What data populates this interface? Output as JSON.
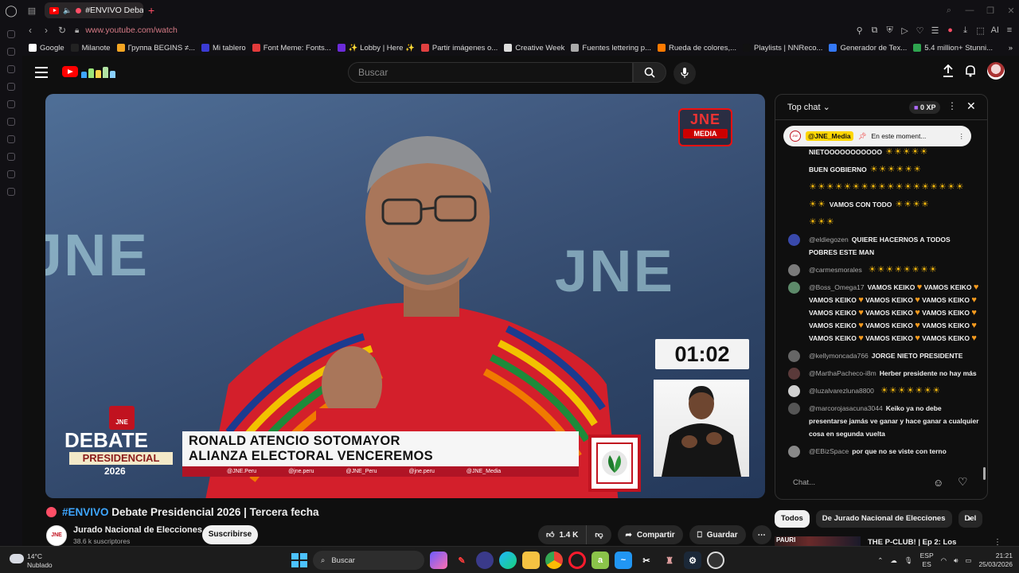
{
  "browser": {
    "tab_title": "#ENVIVO Debate P",
    "url": "www.youtube.com/watch",
    "ai_label": "AI",
    "bookmarks": [
      {
        "label": "Google",
        "color": "#ffffff"
      },
      {
        "label": "Milanote",
        "color": "#222222"
      },
      {
        "label": "Группа BEGINS ≠...",
        "color": "#f5a623"
      },
      {
        "label": "Mi tablero",
        "color": "#3b3bd4"
      },
      {
        "label": "Font Meme: Fonts...",
        "color": "#e23b3b"
      },
      {
        "label": "✨ Lobby | Here ✨",
        "color": "#6c2bd9"
      },
      {
        "label": "Partir imágenes o...",
        "color": "#e04040"
      },
      {
        "label": "Creative Week",
        "color": "#dddddd"
      },
      {
        "label": "Fuentes lettering p...",
        "color": "#aaaaaa"
      },
      {
        "label": "Rueda de colores,...",
        "color": "#ff7a00"
      },
      {
        "label": "Playlists | NNReco...",
        "color": "#111111"
      },
      {
        "label": "Generador de Tex...",
        "color": "#3478f6"
      },
      {
        "label": "5.4 million+ Stunni...",
        "color": "#2ea44f"
      }
    ]
  },
  "youtube": {
    "search_placeholder": "Buscar",
    "video": {
      "watermark": "JNE",
      "broadcaster_logo_top": "JNE",
      "broadcaster_logo_bottom": "MEDIA",
      "timer": "01:02",
      "debate_badge_top": "DEBATE",
      "debate_badge_middle": "PRESIDENCIAL",
      "debate_badge_year": "2026",
      "jne_badge": "JNE",
      "candidate_name": "RONALD ATENCIO SOTOMAYOR",
      "candidate_party": "ALIANZA ELECTORAL VENCEREMOS",
      "socials": [
        "@JNE.Peru",
        "@jne.peru",
        "@JNE_Peru",
        "@jne.peru",
        "@JNE_Media"
      ]
    },
    "title_tag": "#ENVIVO",
    "title_rest": " Debate Presidencial 2026 | Tercera fecha",
    "channel": {
      "name": "Jurado Nacional de Elecciones",
      "subscribers": "38.6 k suscriptores",
      "avatar_text": "JNE",
      "subscribe_label": "Suscribirse"
    },
    "actions": {
      "likes": "1.4 K",
      "share": "Compartir",
      "save": "Guardar"
    },
    "chat": {
      "title": "Top chat",
      "xp": "0 XP",
      "pinned_user": "@JNE_Media",
      "pinned_text": "En este moment...",
      "input_placeholder": "Chat...",
      "messages": [
        {
          "user": "",
          "text": "NIETOOOOOOOOOOO",
          "suns_after": 5,
          "avatar": ""
        },
        {
          "user": "",
          "text": "BUEN GOBIERNO",
          "suns_after": 6,
          "avatar": ""
        },
        {
          "user": "",
          "text": "",
          "suns_after": 18,
          "avatar": ""
        },
        {
          "user": "",
          "text": "VAMOS CON TODO",
          "suns_after": 4,
          "suns_before": 2,
          "avatar": ""
        },
        {
          "user": "",
          "text": "",
          "suns_after": 3,
          "avatar": ""
        },
        {
          "user": "@eldiegozen",
          "text": "QUIERE HACERNOS A TODOS POBRES ESTE MAN",
          "avatar": "#3949ab"
        },
        {
          "user": "@carmesmorales",
          "text": "",
          "suns_after": 8,
          "avatar": "#7a7a7a"
        },
        {
          "user": "@Boss_Omega17",
          "text": "VAMOS KEIKO 🧡 VAMOS KEIKO 🧡 VAMOS KEIKO 🧡 VAMOS KEIKO 🧡 VAMOS KEIKO 🧡 VAMOS KEIKO 🧡 VAMOS KEIKO 🧡 VAMOS KEIKO 🧡 VAMOS KEIKO 🧡 VAMOS KEIKO 🧡 VAMOS KEIKO 🧡 VAMOS KEIKO 🧡 VAMOS KEIKO 🧡 VAMOS KEIKO 🧡",
          "avatar": "#5d8a6a"
        },
        {
          "user": "@kellymoncada766",
          "text": "JORGE NIETO PRESIDENTE",
          "avatar": "#666666"
        },
        {
          "user": "@MarthaPacheco-i8m",
          "text": "Herber presidente no hay más",
          "avatar": "#5a3a3a"
        },
        {
          "user": "@luzalvarezluna8800",
          "text": "",
          "suns_after": 7,
          "avatar": "#d0d0d0"
        },
        {
          "user": "@marcorojasacuna3044",
          "text": "Keiko ya no debe presentarse jamás ve ganar y hace ganar a cualquier cosa en segunda vuelta",
          "avatar": "#555555"
        },
        {
          "user": "@EBizSpace",
          "text": "por que no se viste con terno",
          "avatar": "#888888"
        }
      ]
    },
    "chips": [
      "Todos",
      "De Jurado Nacional de Elecciones",
      "Del"
    ],
    "recommended": {
      "thumb_label": "PAURI",
      "title": "THE P-CLUB! | Ep 2: Los"
    }
  },
  "taskbar": {
    "temperature": "14°C",
    "condition": "Nublado",
    "search_label": "Buscar",
    "lang_top": "ESP",
    "lang_bottom": "ES",
    "time": "21:21",
    "date": "25/03/2026"
  }
}
